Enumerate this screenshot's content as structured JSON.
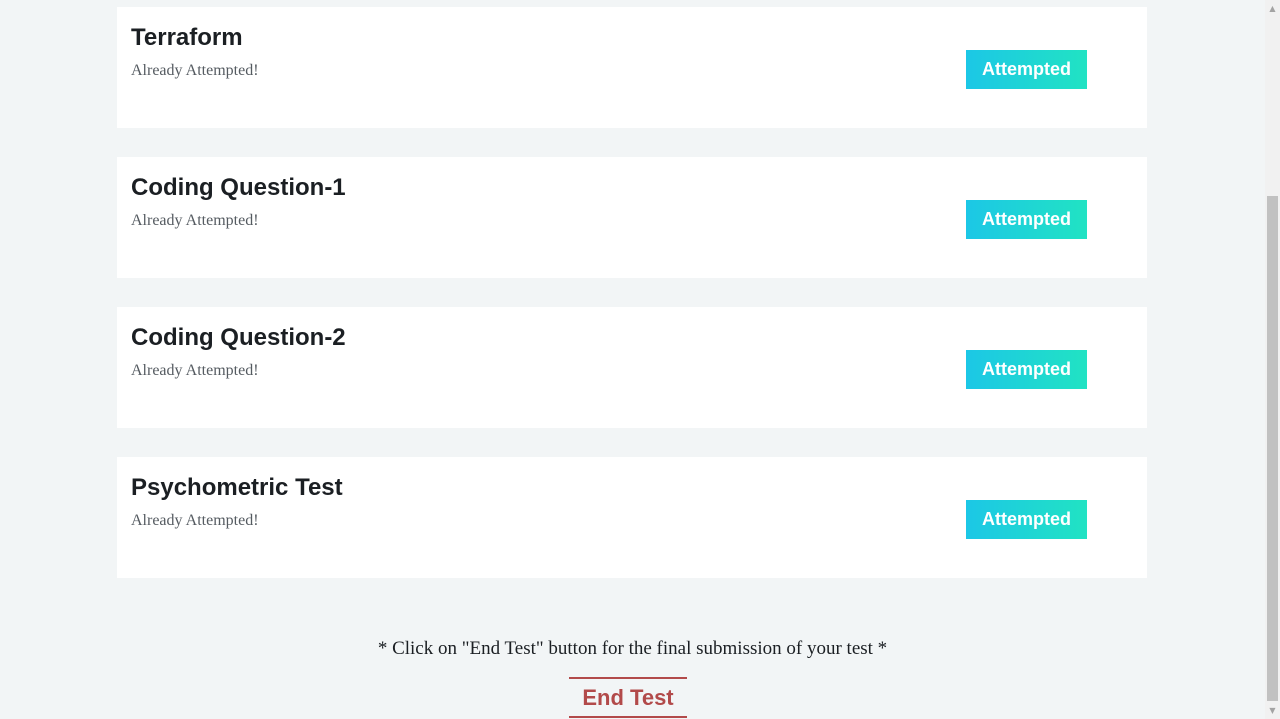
{
  "tests": [
    {
      "title": "Terraform",
      "status": "Already Attempted!",
      "button_label": "Attempted"
    },
    {
      "title": "Coding Question-1",
      "status": "Already Attempted!",
      "button_label": "Attempted"
    },
    {
      "title": "Coding Question-2",
      "status": "Already Attempted!",
      "button_label": "Attempted"
    },
    {
      "title": "Psychometric Test",
      "status": "Already Attempted!",
      "button_label": "Attempted"
    }
  ],
  "footer": {
    "note": "* Click on \"End Test\" button for the final submission of your test *",
    "end_button_label": "End Test"
  },
  "colors": {
    "accent_gradient_start": "#1cc7e6",
    "accent_gradient_end": "#21e3c3",
    "end_button": "#b24a4a",
    "background": "#f2f5f6"
  },
  "scrollbar": {
    "up_icon": "scroll-up-arrow-icon",
    "down_icon": "scroll-down-arrow-icon"
  }
}
